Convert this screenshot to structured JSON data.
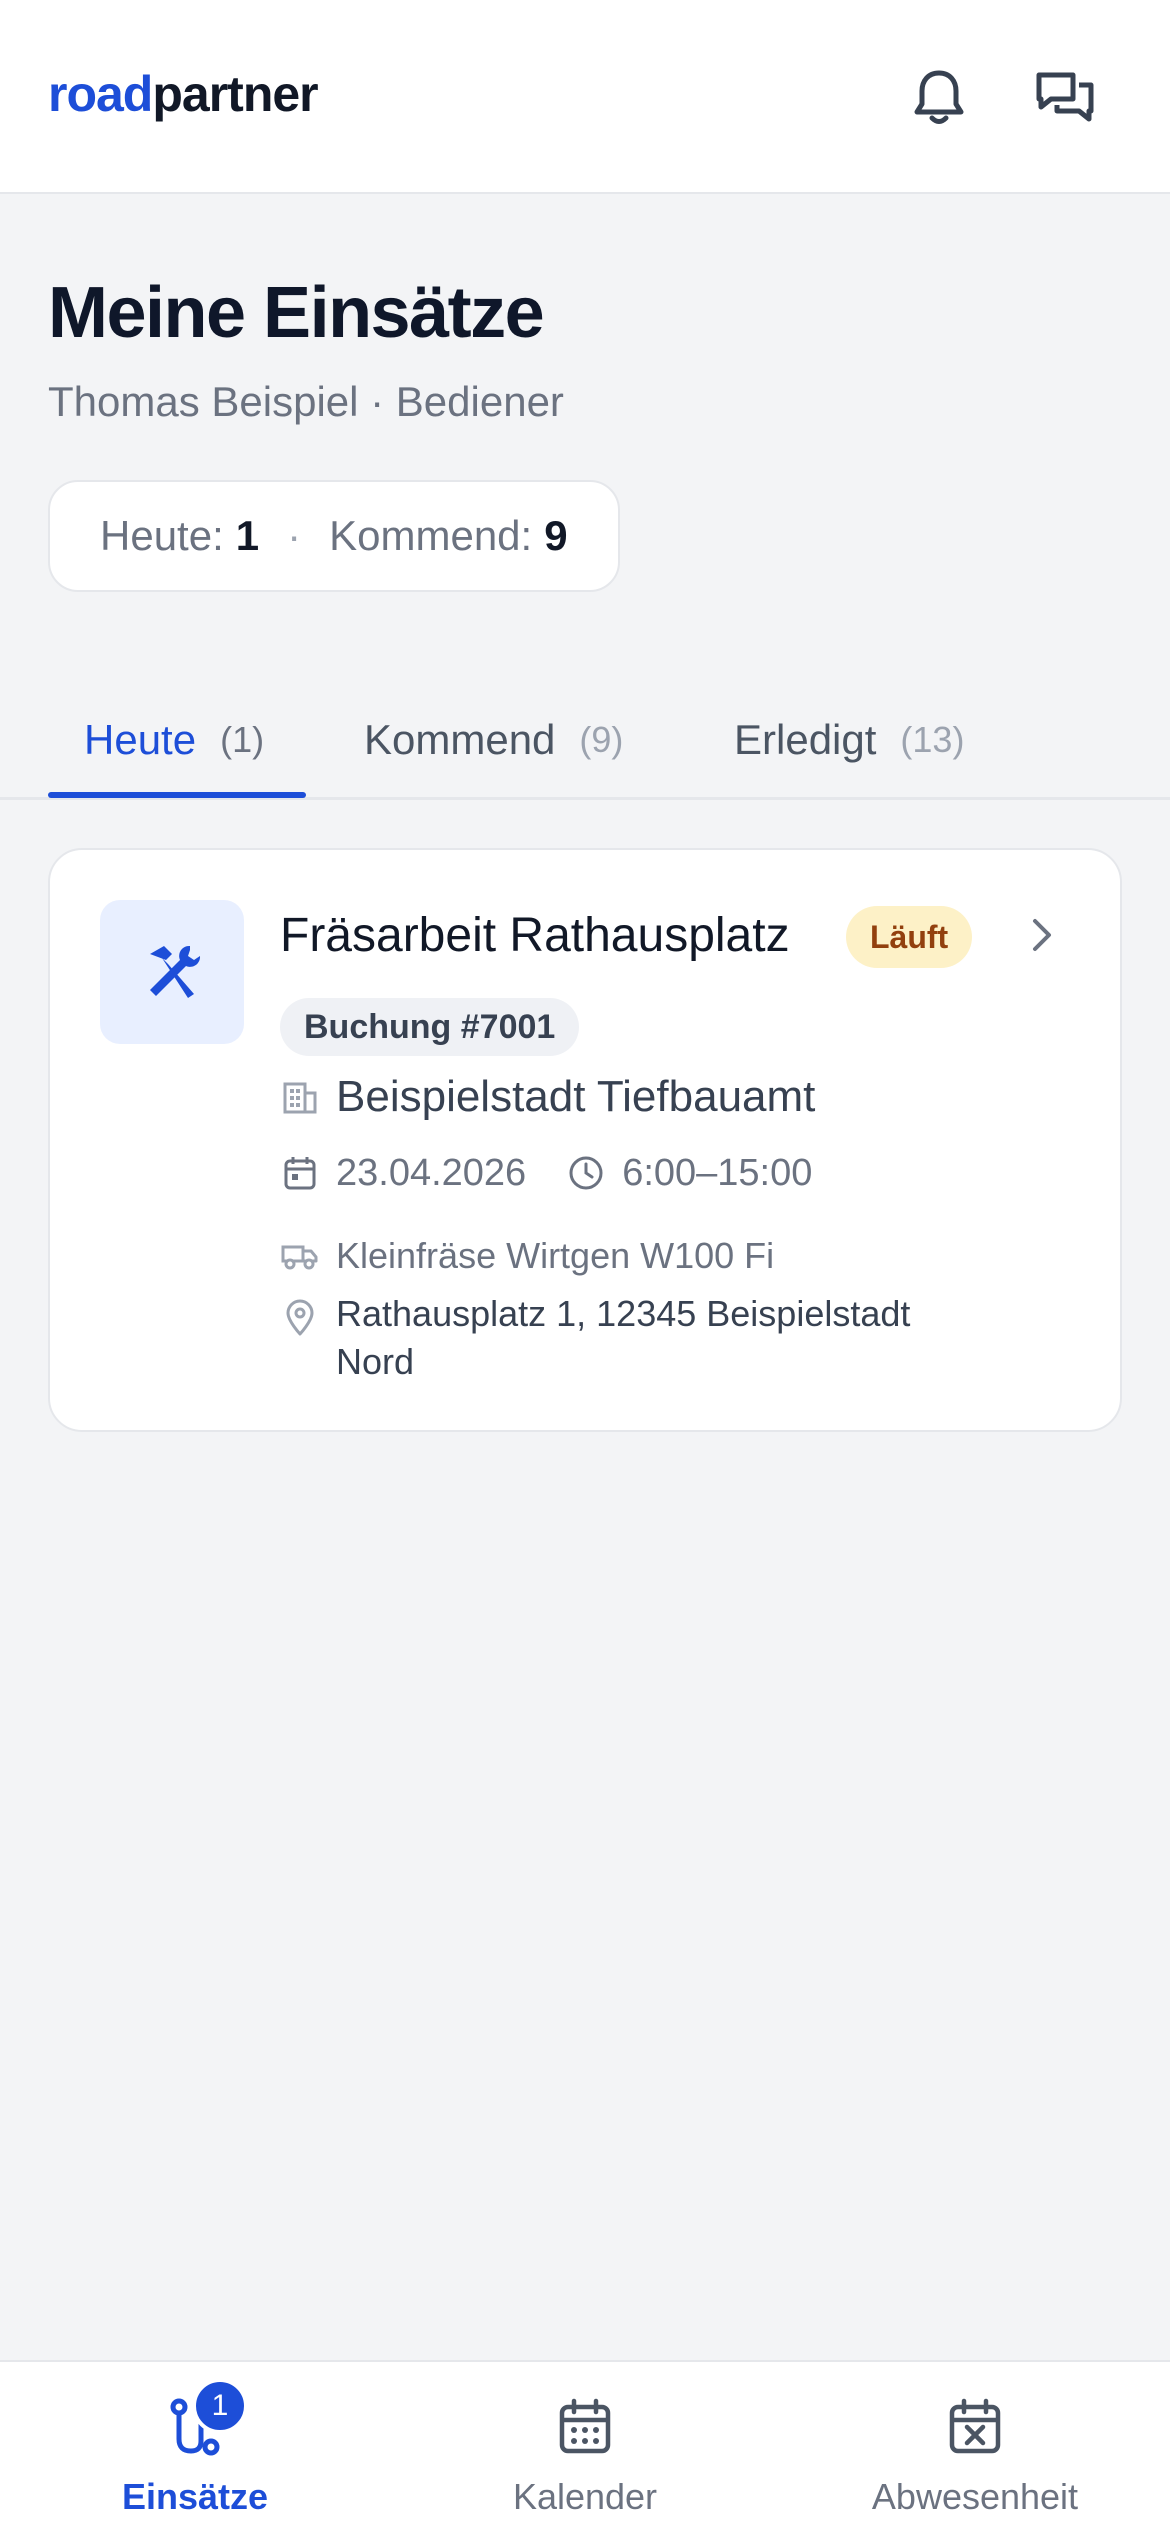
{
  "header": {
    "logo_part1": "road",
    "logo_part2": "partner",
    "icons": [
      "bell-icon",
      "chat-icon"
    ]
  },
  "page": {
    "title": "Meine Einsätze",
    "subtitle": "Thomas Beispiel · Bediener"
  },
  "summary": {
    "today_label": "Heute:",
    "today_value": "1",
    "separator": "·",
    "upcoming_label": "Kommend:",
    "upcoming_value": "9"
  },
  "tabs": [
    {
      "label": "Heute",
      "count": "(1)",
      "active": true
    },
    {
      "label": "Kommend",
      "count": "(9)",
      "active": false
    },
    {
      "label": "Erledigt",
      "count": "(13)",
      "active": false
    }
  ],
  "assignment": {
    "title": "Fräsarbeit Rathausplatz",
    "status": "Läuft",
    "booking": "Buchung #7001",
    "company": "Beispielstadt Tiefbauamt",
    "date": "23.04.2026",
    "time": "6:00–15:00",
    "machine": "Kleinfräse Wirtgen W100 Fi",
    "address": "Rathausplatz 1, 12345 Beispielstadt Nord"
  },
  "bottom_nav": [
    {
      "label": "Einsätze",
      "badge": "1",
      "active": true
    },
    {
      "label": "Kalender",
      "active": false
    },
    {
      "label": "Abwesenheit",
      "active": false
    }
  ],
  "colors": {
    "accent": "#1d4ed8",
    "status_bg": "#fdf1c7",
    "status_text": "#92400e",
    "background": "#f3f4f6"
  }
}
